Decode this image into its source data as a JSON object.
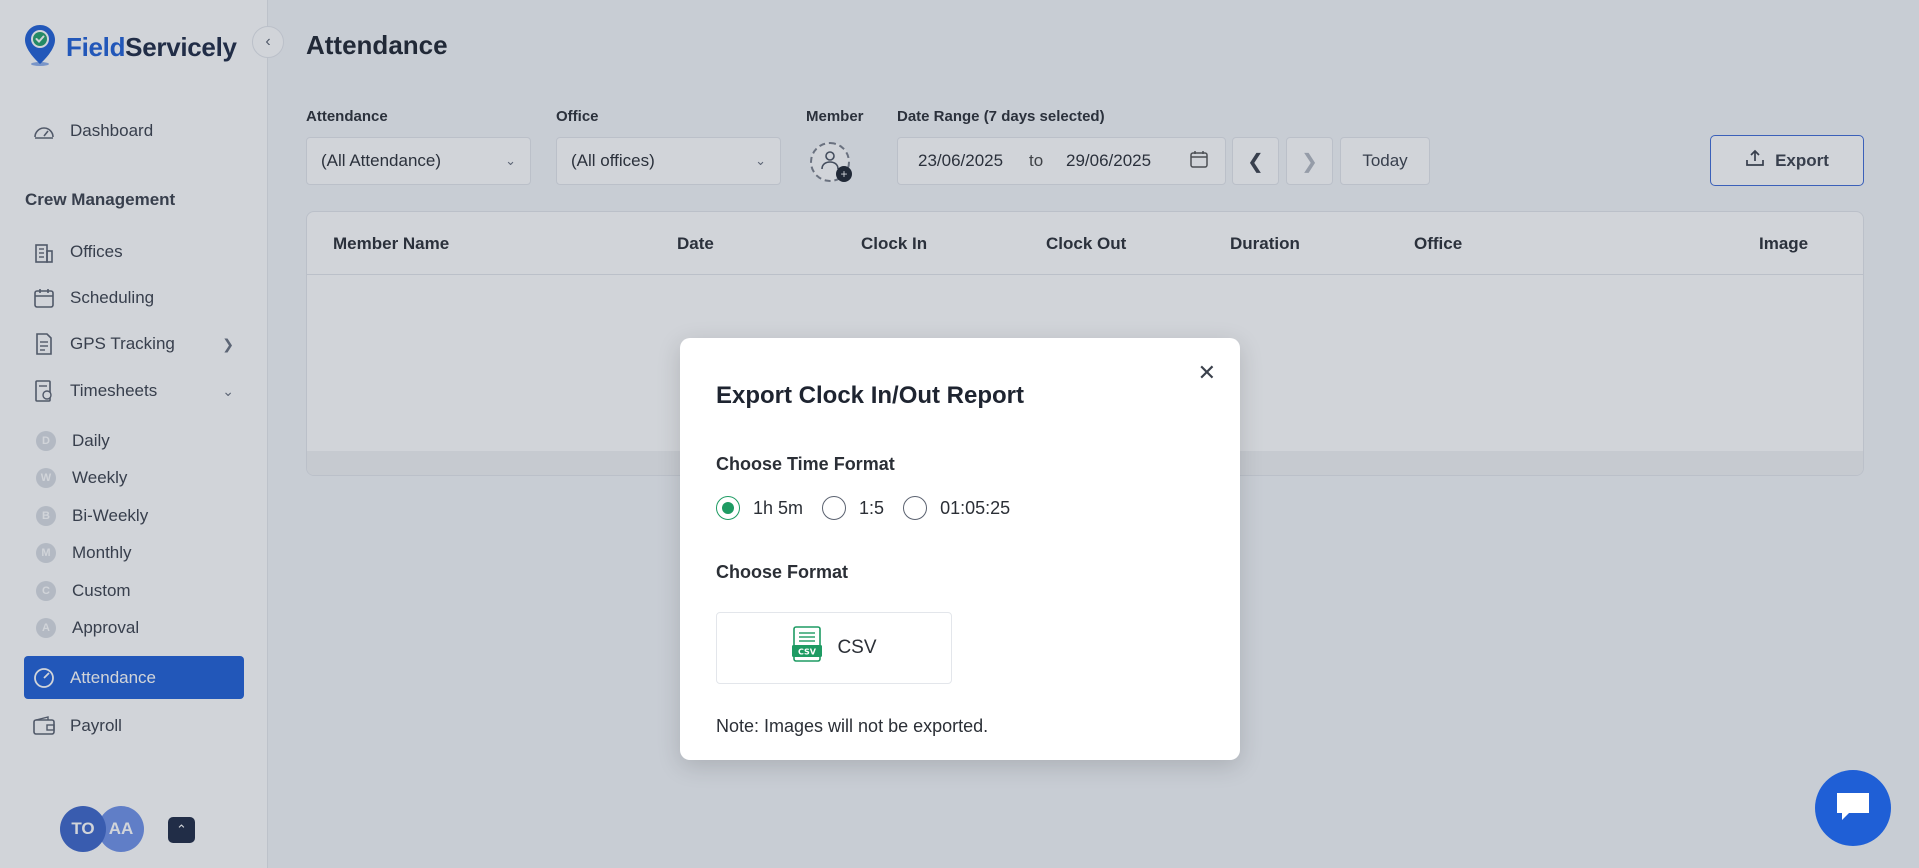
{
  "app": {
    "brand_part1": "Field",
    "brand_part2": "Servicely"
  },
  "sidebar": {
    "items": [
      {
        "label": "Dashboard",
        "icon": "gauge-icon"
      },
      {
        "label": "Offices",
        "icon": "building-icon"
      },
      {
        "label": "Scheduling",
        "icon": "calendar-icon"
      },
      {
        "label": "GPS Tracking",
        "icon": "document-icon"
      },
      {
        "label": "Timesheets",
        "icon": "timesheet-icon"
      },
      {
        "label": "Attendance",
        "icon": "attendance-icon",
        "active": true
      },
      {
        "label": "Payroll",
        "icon": "wallet-icon"
      }
    ],
    "section_title": "Crew Management",
    "timesheet_subitems": [
      {
        "letter": "D",
        "label": "Daily"
      },
      {
        "letter": "W",
        "label": "Weekly"
      },
      {
        "letter": "B",
        "label": "Bi-Weekly"
      },
      {
        "letter": "M",
        "label": "Monthly"
      },
      {
        "letter": "C",
        "label": "Custom"
      },
      {
        "letter": "A",
        "label": "Approval"
      }
    ],
    "avatars": [
      "TO",
      "AA"
    ]
  },
  "main": {
    "title": "Attendance",
    "filters": {
      "attendance_label": "Attendance",
      "attendance_value": "(All Attendance)",
      "office_label": "Office",
      "office_value": "(All offices)",
      "member_label": "Member",
      "date_range_label": "Date Range (7 days selected)",
      "date_from": "23/06/2025",
      "date_to_word": "to",
      "date_to": "29/06/2025",
      "today_label": "Today",
      "export_label": "Export"
    },
    "table": {
      "columns": [
        "Member Name",
        "Date",
        "Clock In",
        "Clock Out",
        "Duration",
        "Office",
        "Image"
      ]
    }
  },
  "modal": {
    "title": "Export Clock In/Out Report",
    "time_format_label": "Choose Time Format",
    "time_formats": [
      {
        "label": "1h 5m",
        "selected": true
      },
      {
        "label": "1:5",
        "selected": false
      },
      {
        "label": "01:05:25",
        "selected": false
      }
    ],
    "format_label": "Choose Format",
    "csv_label": "CSV",
    "csv_badge": "CSV",
    "note": "Note: Images will not be exported."
  },
  "colors": {
    "accent": "#1f5fd6",
    "radio_selected": "#1e9b63",
    "brand_dark": "#1e2a44"
  }
}
